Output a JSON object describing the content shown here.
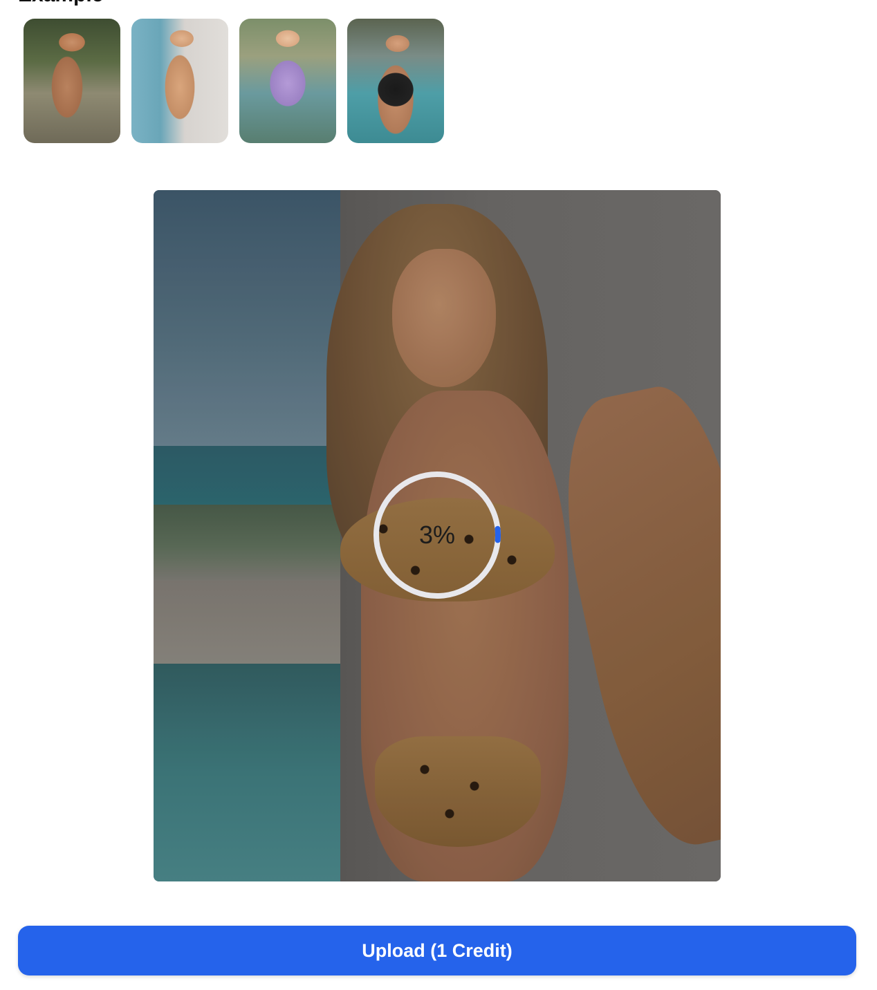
{
  "examples": {
    "title": "Example",
    "thumbnails": [
      {
        "name": "example-thumbnail-1"
      },
      {
        "name": "example-thumbnail-2"
      },
      {
        "name": "example-thumbnail-3"
      },
      {
        "name": "example-thumbnail-4"
      }
    ]
  },
  "preview": {
    "progress_percent": 3,
    "progress_label": "3%"
  },
  "upload_button": {
    "label": "Upload (1 Credit)"
  },
  "colors": {
    "accent": "#2563eb",
    "progress_track": "#e8e8ec",
    "progress_fill": "#2563eb"
  }
}
